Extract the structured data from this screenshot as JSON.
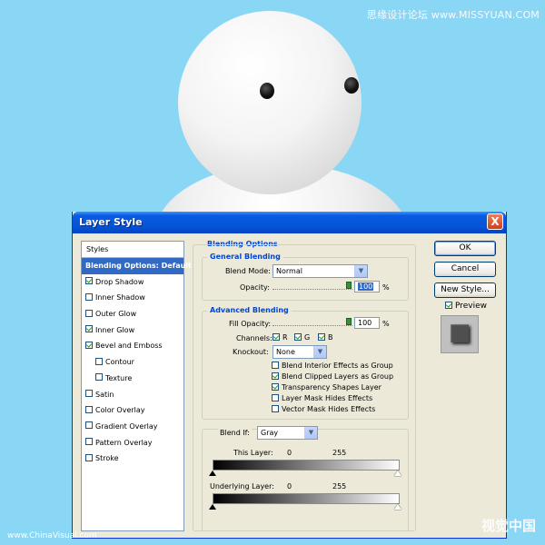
{
  "watermarks": {
    "top_right": "思缘设计论坛 www.MISSYUAN.COM",
    "bottom_left": "www.ChinaVisual.com",
    "bottom_right": "视觉中国"
  },
  "dialog": {
    "title": "Layer Style",
    "close_label": "X",
    "styles_header": "Styles",
    "styles": [
      {
        "label": "Blending Options: Default",
        "selected": true,
        "checkbox": false,
        "checked": false,
        "indent": false
      },
      {
        "label": "Drop Shadow",
        "selected": false,
        "checkbox": true,
        "checked": true,
        "indent": false
      },
      {
        "label": "Inner Shadow",
        "selected": false,
        "checkbox": true,
        "checked": false,
        "indent": false
      },
      {
        "label": "Outer Glow",
        "selected": false,
        "checkbox": true,
        "checked": false,
        "indent": false
      },
      {
        "label": "Inner Glow",
        "selected": false,
        "checkbox": true,
        "checked": true,
        "indent": false
      },
      {
        "label": "Bevel and Emboss",
        "selected": false,
        "checkbox": true,
        "checked": true,
        "indent": false
      },
      {
        "label": "Contour",
        "selected": false,
        "checkbox": true,
        "checked": false,
        "indent": true
      },
      {
        "label": "Texture",
        "selected": false,
        "checkbox": true,
        "checked": false,
        "indent": true
      },
      {
        "label": "Satin",
        "selected": false,
        "checkbox": true,
        "checked": false,
        "indent": false
      },
      {
        "label": "Color Overlay",
        "selected": false,
        "checkbox": true,
        "checked": false,
        "indent": false
      },
      {
        "label": "Gradient Overlay",
        "selected": false,
        "checkbox": true,
        "checked": false,
        "indent": false
      },
      {
        "label": "Pattern Overlay",
        "selected": false,
        "checkbox": true,
        "checked": false,
        "indent": false
      },
      {
        "label": "Stroke",
        "selected": false,
        "checkbox": true,
        "checked": false,
        "indent": false
      }
    ],
    "blending_options": {
      "heading": "Blending Options",
      "general": {
        "heading": "General Blending",
        "blend_mode_label": "Blend Mode:",
        "blend_mode": "Normal",
        "opacity_label": "Opacity:",
        "opacity": "100",
        "percent": "%"
      },
      "advanced": {
        "heading": "Advanced Blending",
        "fill_opacity_label": "Fill Opacity:",
        "fill_opacity": "100",
        "percent": "%",
        "channels_label": "Channels:",
        "channels": [
          {
            "label": "R",
            "checked": true
          },
          {
            "label": "G",
            "checked": true
          },
          {
            "label": "B",
            "checked": true
          }
        ],
        "knockout_label": "Knockout:",
        "knockout": "None",
        "options": [
          {
            "label": "Blend Interior Effects as Group",
            "checked": false
          },
          {
            "label": "Blend Clipped Layers as Group",
            "checked": true
          },
          {
            "label": "Transparency Shapes Layer",
            "checked": true
          },
          {
            "label": "Layer Mask Hides Effects",
            "checked": false
          },
          {
            "label": "Vector Mask Hides Effects",
            "checked": false
          }
        ]
      },
      "blend_if": {
        "label": "Blend If:",
        "channel": "Gray",
        "this_layer_label": "This Layer:",
        "this_layer_min": "0",
        "this_layer_max": "255",
        "underlying_label": "Underlying Layer:",
        "underlying_min": "0",
        "underlying_max": "255"
      }
    },
    "buttons": {
      "ok": "OK",
      "cancel": "Cancel",
      "new_style": "New Style..."
    },
    "preview_label": "Preview",
    "preview_checked": true
  }
}
